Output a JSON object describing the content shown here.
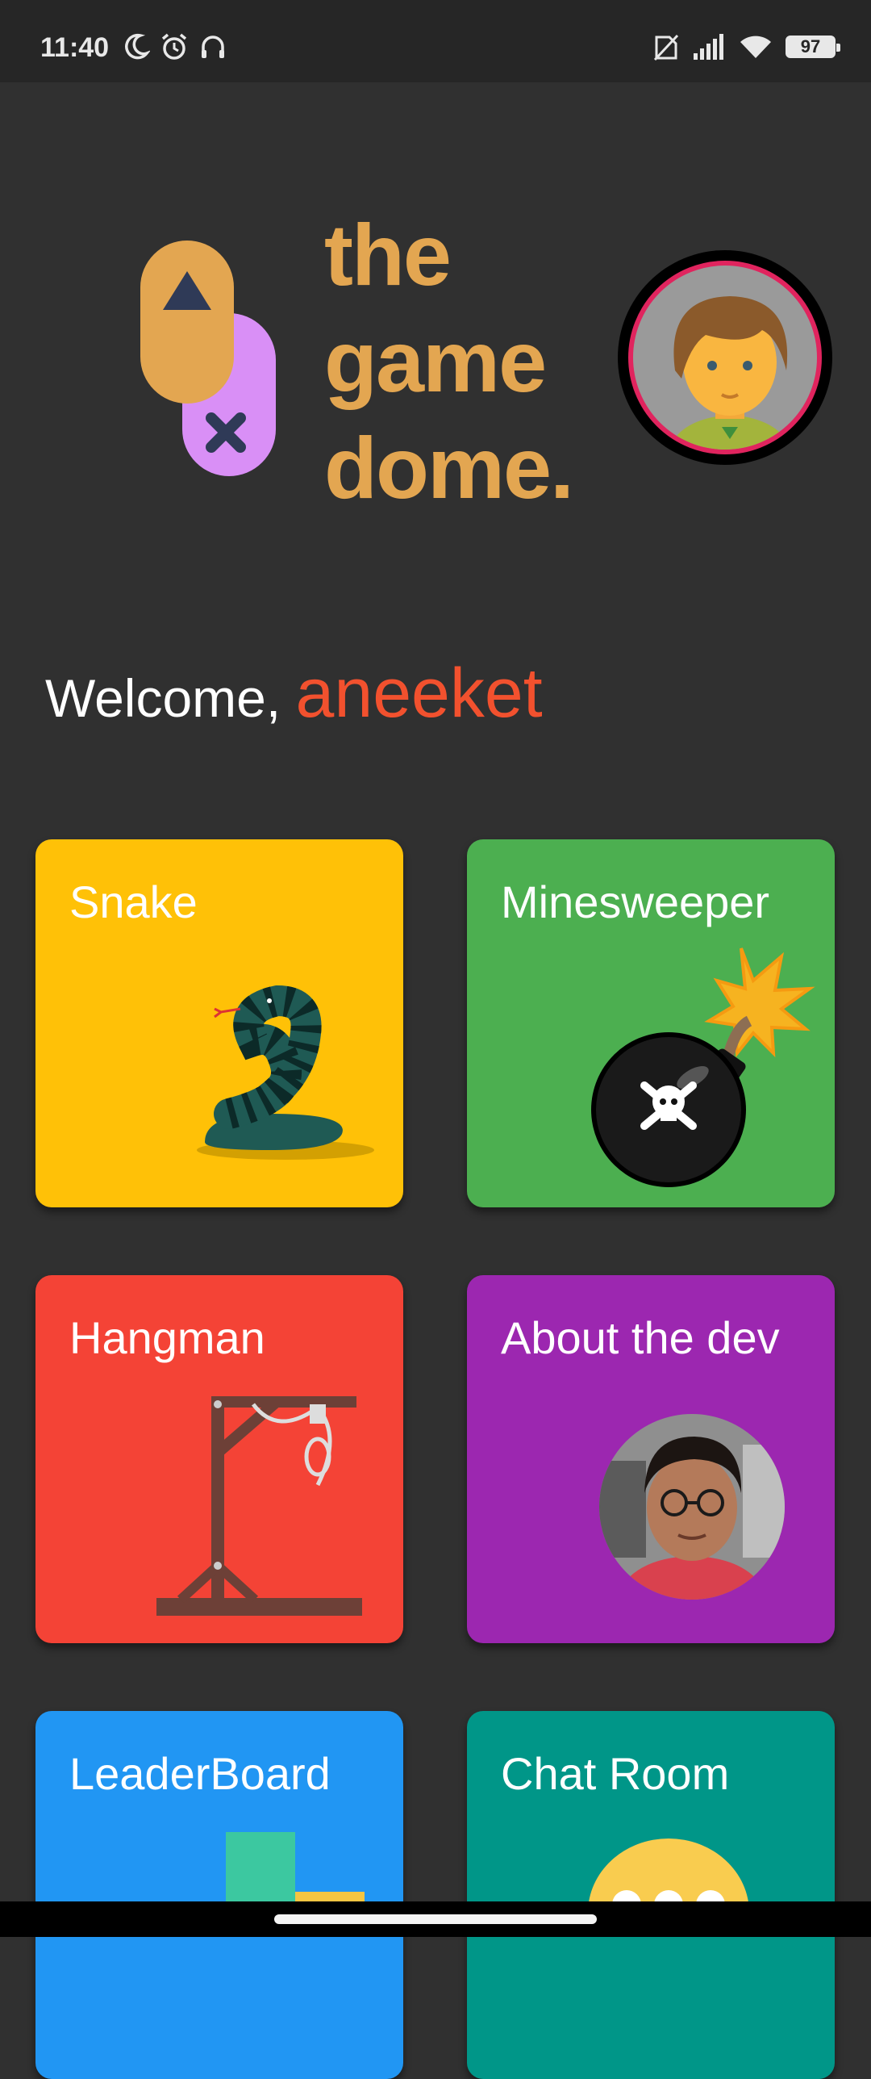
{
  "status_bar": {
    "time": "11:40",
    "left_icons": [
      "moon-icon",
      "alarm-icon",
      "headset-icon"
    ],
    "right_icons": [
      "no-sim-icon",
      "signal-icon",
      "wifi-icon",
      "battery-icon"
    ],
    "battery": "97"
  },
  "logo": {
    "line1": "the",
    "line2": "game",
    "line3": "dome."
  },
  "welcome": {
    "prefix": "Welcome,",
    "username": "aneeket"
  },
  "cards": [
    {
      "title": "Snake",
      "icon": "snake-icon",
      "color": "#ffc107"
    },
    {
      "title": "Minesweeper",
      "icon": "bomb-icon",
      "color": "#4caf50"
    },
    {
      "title": "Hangman",
      "icon": "gallows-icon",
      "color": "#f44336"
    },
    {
      "title": "About the dev",
      "icon": "developer-photo",
      "color": "#9c27b0"
    },
    {
      "title": "LeaderBoard",
      "icon": "podium-icon",
      "color": "#2196f3"
    },
    {
      "title": "Chat Room",
      "icon": "chat-bubble-icon",
      "color": "#009688"
    }
  ],
  "colors": {
    "background": "#303030",
    "logo": "#e3a651",
    "username": "#f2512e"
  }
}
